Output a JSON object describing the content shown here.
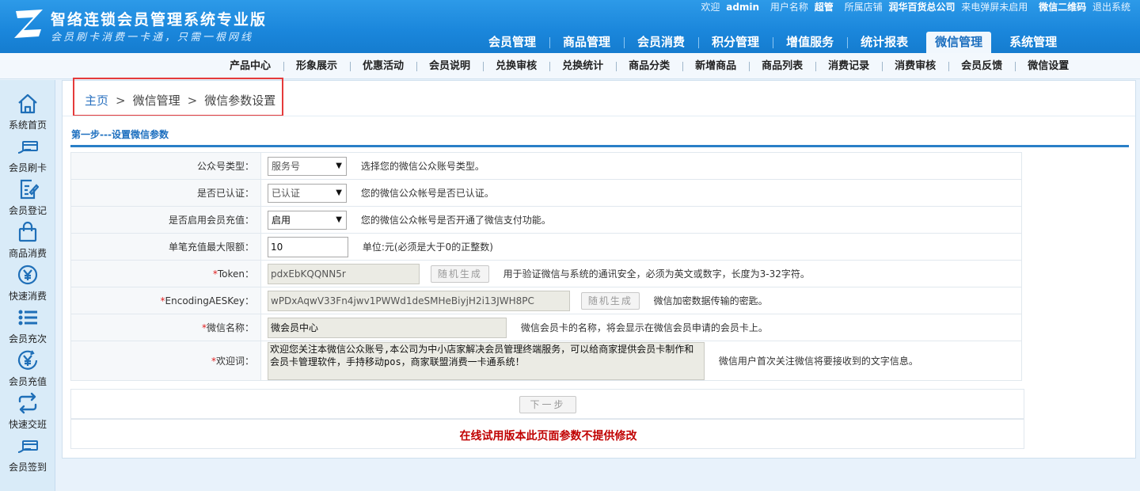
{
  "header": {
    "title": "智络连锁会员管理系统专业版",
    "slogan": "会员刷卡消费一卡通，只需一根网线",
    "welcome_label": "欢迎",
    "username": "admin",
    "username_label": "用户名称",
    "role": "超管",
    "store_label": "所属店铺",
    "store": "润华百货总公司",
    "call_popup": "来电弹屏未启用",
    "wechat_qr": "微信二维码",
    "logout": "退出系统"
  },
  "main_nav": [
    {
      "label": "会员管理"
    },
    {
      "label": "商品管理"
    },
    {
      "label": "会员消费"
    },
    {
      "label": "积分管理"
    },
    {
      "label": "增值服务"
    },
    {
      "label": "统计报表"
    },
    {
      "label": "微信管理",
      "active": true
    },
    {
      "label": "系统管理"
    }
  ],
  "sub_nav": [
    {
      "label": "产品中心"
    },
    {
      "label": "形象展示"
    },
    {
      "label": "优惠活动"
    },
    {
      "label": "会员说明"
    },
    {
      "label": "兑换审核"
    },
    {
      "label": "兑换统计"
    },
    {
      "label": "商品分类"
    },
    {
      "label": "新增商品"
    },
    {
      "label": "商品列表"
    },
    {
      "label": "消费记录"
    },
    {
      "label": "消费审核"
    },
    {
      "label": "会员反馈"
    },
    {
      "label": "微信设置"
    }
  ],
  "sidebar": [
    {
      "label": "系统首页",
      "icon": "home-icon"
    },
    {
      "label": "会员刷卡",
      "icon": "card-swipe-icon"
    },
    {
      "label": "会员登记",
      "icon": "edit-form-icon"
    },
    {
      "label": "商品消费",
      "icon": "shopping-bag-icon"
    },
    {
      "label": "快速消费",
      "icon": "yen-circle-icon"
    },
    {
      "label": "会员充次",
      "icon": "list-icon"
    },
    {
      "label": "会员充值",
      "icon": "yen-recharge-icon"
    },
    {
      "label": "快速交班",
      "icon": "swap-arrows-icon"
    },
    {
      "label": "会员签到",
      "icon": "card-checkin-icon"
    }
  ],
  "breadcrumb": {
    "home": "主页",
    "sep": ">",
    "level1": "微信管理",
    "level2": "微信参数设置"
  },
  "step_title": "第一步---设置微信参数",
  "form": {
    "account_type": {
      "label": "公众号类型：",
      "value": "服务号",
      "hint": "选择您的微信公众账号类型。"
    },
    "verified": {
      "label": "是否已认证：",
      "value": "已认证",
      "hint": "您的微信公众帐号是否已认证。"
    },
    "recharge_enabled": {
      "label": "是否启用会员充值：",
      "value": "启用",
      "hint": "您的微信公众帐号是否开通了微信支付功能。"
    },
    "max_recharge": {
      "label": "单笔充值最大限额：",
      "value": "10",
      "hint": "单位:元(必须是大于0的正整数)"
    },
    "token": {
      "required": "*",
      "label": "Token：",
      "value": "pdxEbKQQNN5r",
      "button": "随机生成",
      "hint": "用于验证微信与系统的通讯安全，必须为英文或数字，长度为3-32字符。"
    },
    "aes_key": {
      "required": "*",
      "label": "EncodingAESKey：",
      "value": "wPDxAqwV33Fn4jwv1PWWd1deSMHeBiyjH2i13JWH8PC",
      "button": "随机生成",
      "hint": "微信加密数据传输的密匙。"
    },
    "wechat_name": {
      "required": "*",
      "label": "微信名称：",
      "value": "微会员中心",
      "hint": "微信会员卡的名称，将会显示在微信会员申请的会员卡上。"
    },
    "welcome": {
      "required": "*",
      "label": "欢迎词：",
      "value": "欢迎您关注本微信公众账号,本公司为中小店家解决会员管理终端服务，可以给商家提供会员卡制作和会员卡管理软件，手持移动pos，商家联盟消费一卡通系统！",
      "hint": "微信用户首次关注微信将要接收到的文字信息。"
    }
  },
  "next_button": "下一步",
  "notice": "在线试用版本此页面参数不提供修改",
  "colors": {
    "header": "#1a86db",
    "accent": "#2a7fc7",
    "highlight_box": "#e53b3b",
    "notice": "#c00000"
  }
}
